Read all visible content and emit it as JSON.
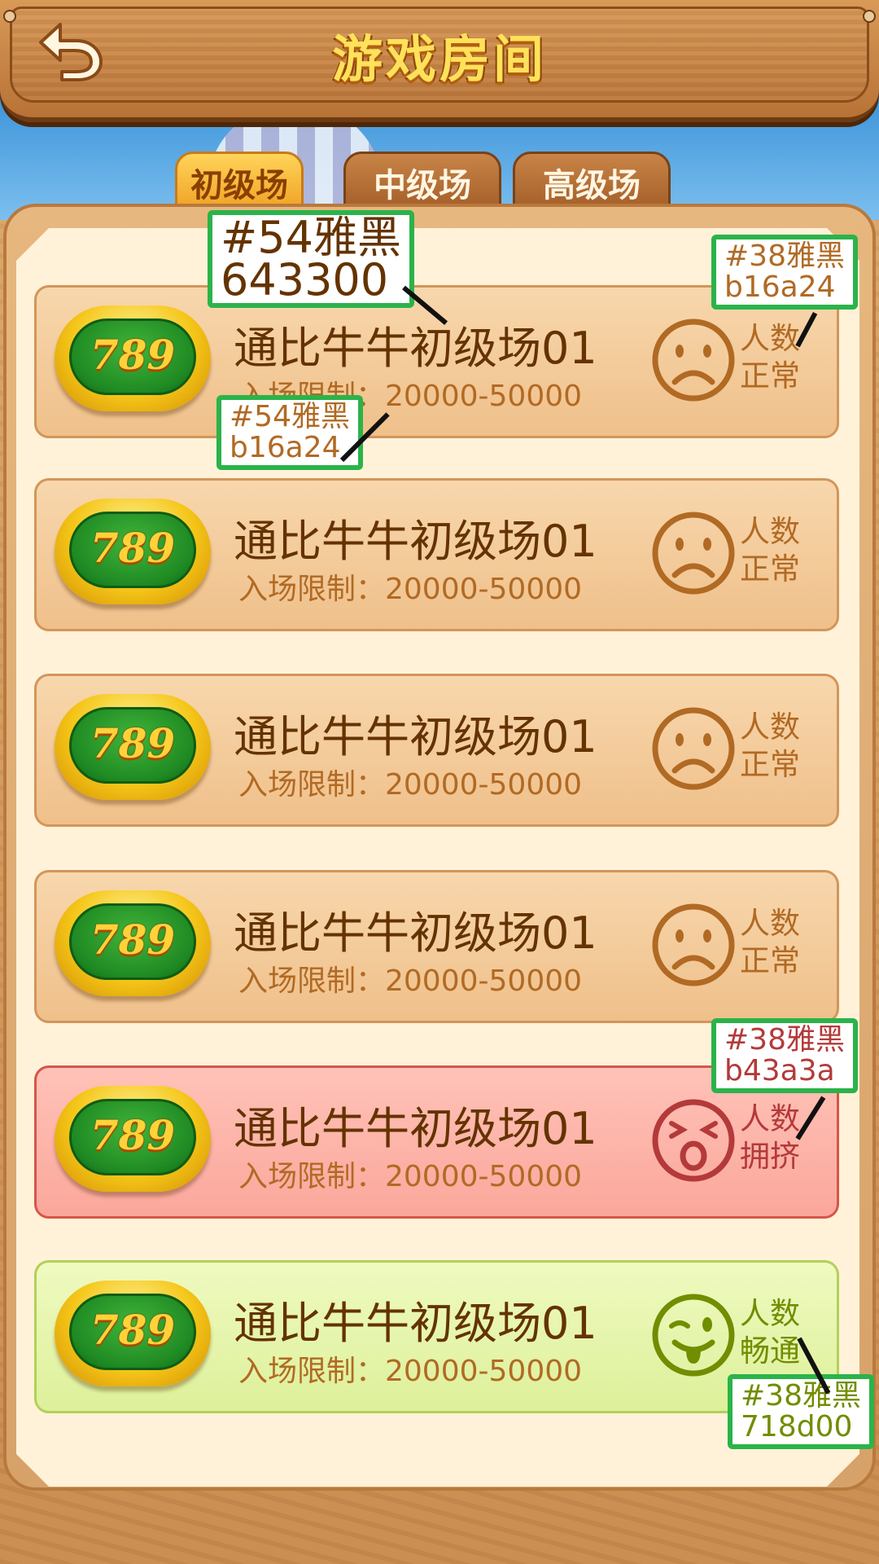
{
  "header": {
    "title": "游戏房间",
    "back_icon": "back-arrow-icon"
  },
  "tabs": [
    {
      "label": "初级场",
      "active": true
    },
    {
      "label": "中级场",
      "active": false
    },
    {
      "label": "高级场",
      "active": false
    }
  ],
  "rooms": [
    {
      "name": "通比牛牛初级场01",
      "limit": "入场限制：20000-50000",
      "status": "人数\n正常",
      "face": "sad-face-icon",
      "state": "normal"
    },
    {
      "name": "通比牛牛初级场01",
      "limit": "入场限制：20000-50000",
      "status": "人数\n正常",
      "face": "sad-face-icon",
      "state": "normal"
    },
    {
      "name": "通比牛牛初级场01",
      "limit": "入场限制：20000-50000",
      "status": "人数\n正常",
      "face": "sad-face-icon",
      "state": "normal"
    },
    {
      "name": "通比牛牛初级场01",
      "limit": "入场限制：20000-50000",
      "status": "人数\n正常",
      "face": "sad-face-icon",
      "state": "normal"
    },
    {
      "name": "通比牛牛初级场01",
      "limit": "入场限制：20000-50000",
      "status": "人数\n拥挤",
      "face": "shocked-face-icon",
      "state": "crowded"
    },
    {
      "name": "通比牛牛初级场01",
      "limit": "入场限制：20000-50000",
      "status": "人数\n畅通",
      "face": "wink-tongue-face-icon",
      "state": "smooth"
    }
  ],
  "logo_text": "789",
  "colors": {
    "room_name": "#643300",
    "room_limit": "#b16a24",
    "status_normal": "#b16a24",
    "status_crowded": "#b43a3a",
    "status_smooth": "#718d00",
    "callout_border": "#2bb34a"
  },
  "annotations": [
    {
      "line1": "#54雅黑",
      "line2": "643300"
    },
    {
      "line1": "#54雅黑",
      "line2": "b16a24"
    },
    {
      "line1": "#38雅黑",
      "line2": "b16a24"
    },
    {
      "line1": "#38雅黑",
      "line2": "b43a3a"
    },
    {
      "line1": "#38雅黑",
      "line2": "718d00"
    }
  ]
}
